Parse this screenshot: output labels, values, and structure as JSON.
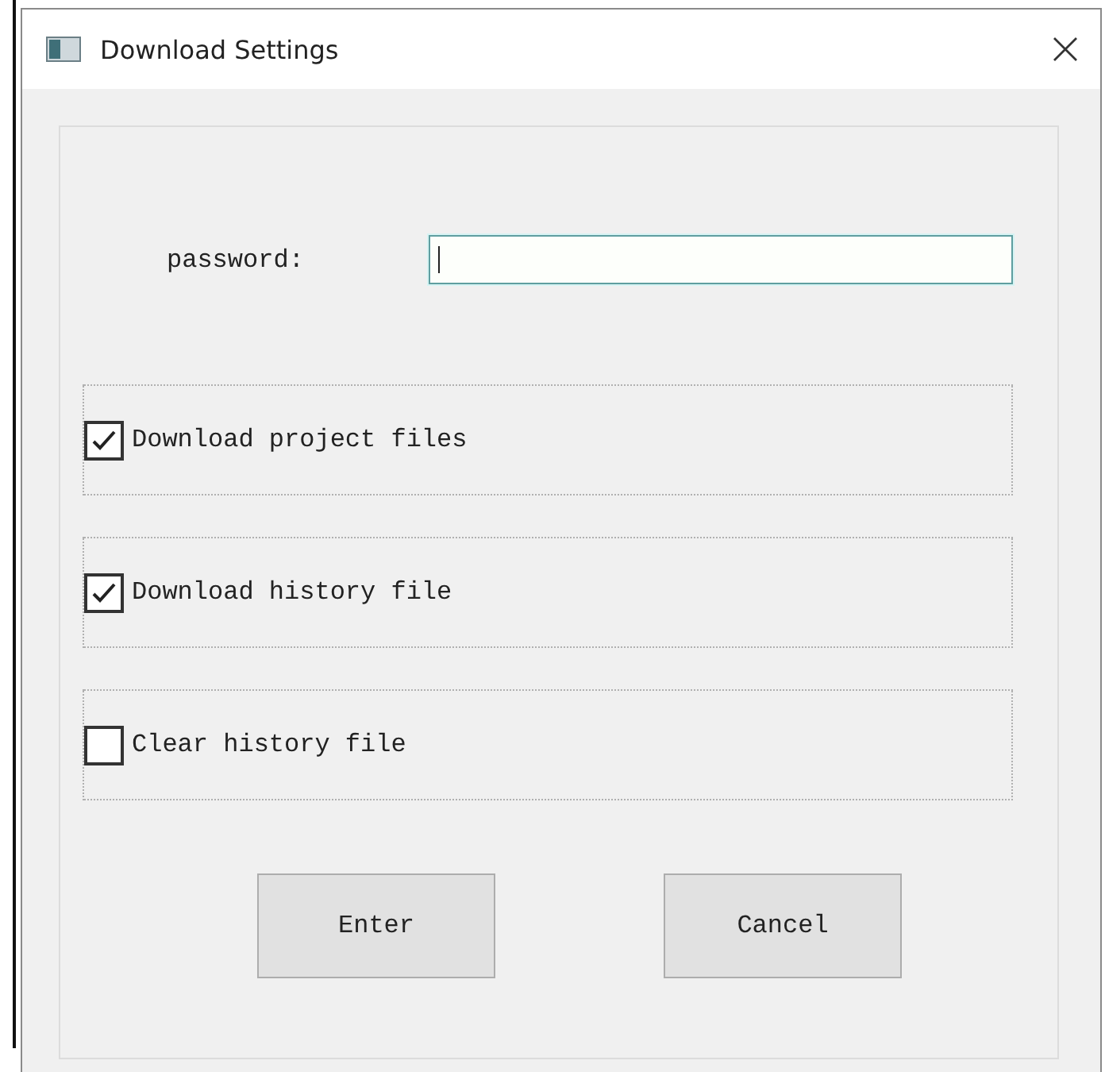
{
  "window": {
    "title": "Download Settings"
  },
  "password": {
    "label": "password:",
    "focused": true
  },
  "options": [
    {
      "label": "Download project files",
      "checked": true
    },
    {
      "label": "Download history file",
      "checked": true
    },
    {
      "label": "Clear history file",
      "checked": false
    }
  ],
  "buttons": [
    "Enter",
    "Cancel"
  ]
}
